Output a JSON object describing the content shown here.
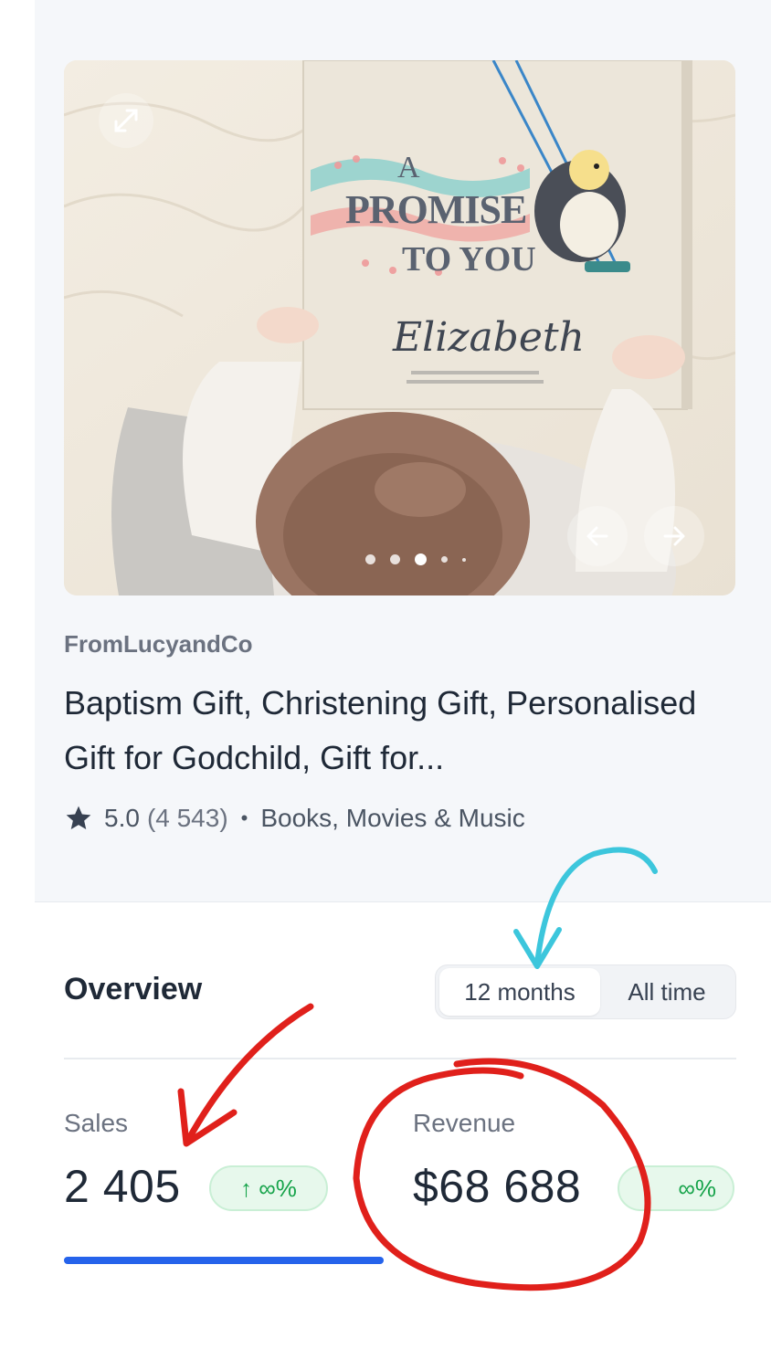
{
  "product": {
    "image": {
      "book_title_lines": [
        "A",
        "PROMISE",
        "TO YOU"
      ],
      "book_name": "Elizabeth",
      "slide_count": 5,
      "active_slide": 3
    },
    "shop": "FromLucyandCo",
    "title": "Baptism Gift, Christening Gift, Personalised Gift for Godchild, Gift for...",
    "rating": "5.0",
    "review_count": "(4 543)",
    "separator": "•",
    "category": "Books, Movies & Music"
  },
  "overview": {
    "title": "Overview",
    "periods": [
      {
        "label": "12 months",
        "selected": true
      },
      {
        "label": "All time",
        "selected": false
      }
    ],
    "stats": [
      {
        "label": "Sales",
        "value": "2 405",
        "change": "↑ ∞%"
      },
      {
        "label": "Revenue",
        "value": "$68 688",
        "change": "∞%"
      }
    ]
  },
  "colors": {
    "accent": "#2563eb",
    "badge_green": "#16a34a",
    "annotation_red": "#e0201b",
    "annotation_cyan": "#3cc6dc"
  },
  "icons": [
    "expand-icon",
    "arrow-left-icon",
    "arrow-right-icon",
    "star-icon",
    "arrow-up-icon"
  ]
}
